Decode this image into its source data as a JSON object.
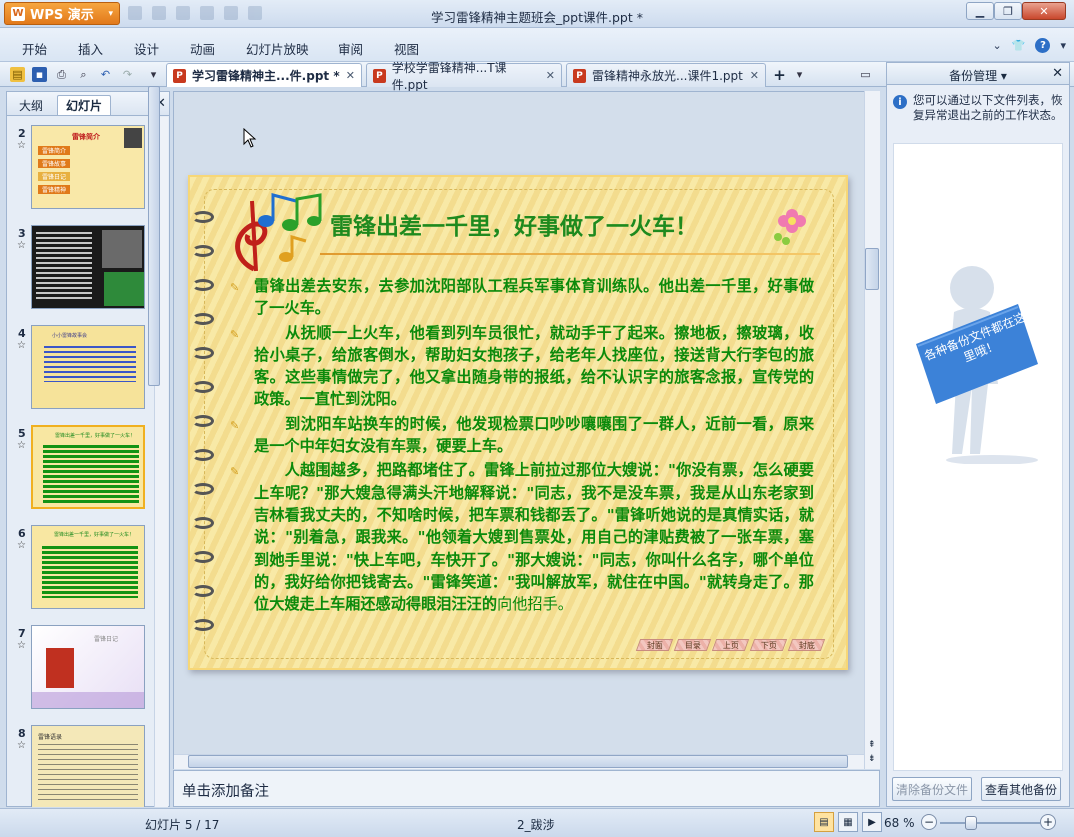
{
  "app": {
    "name": "WPS 演示",
    "window_title": "学习雷锋精神主题班会_ppt课件.ppt *"
  },
  "menu": [
    "开始",
    "插入",
    "设计",
    "动画",
    "幻灯片放映",
    "审阅",
    "视图"
  ],
  "doc_tabs": [
    {
      "label": "学习雷锋精神主...件.ppt *",
      "active": true
    },
    {
      "label": "学校学雷锋精神...T课件.ppt",
      "active": false
    },
    {
      "label": "雷锋精神永放光...课件1.ppt",
      "active": false
    }
  ],
  "left_panel": {
    "tabs": [
      "大纲",
      "幻灯片"
    ],
    "active_tab": "幻灯片",
    "slides": [
      {
        "num": "2",
        "title": "雷锋简介",
        "items": [
          "雷锋简介",
          "雷锋故事",
          "雷锋日记",
          "雷锋精神"
        ]
      },
      {
        "num": "3",
        "title": "雷锋"
      },
      {
        "num": "4",
        "title": "小小雷锋故事会"
      },
      {
        "num": "5",
        "title": "雷锋出差一千里，好事做了一火车！"
      },
      {
        "num": "6",
        "title": "雷锋出差一千里，好事做了一火车！"
      },
      {
        "num": "7",
        "title": "雷锋日记"
      },
      {
        "num": "8",
        "title": "雷锋语录"
      }
    ]
  },
  "slide": {
    "title": "雷锋出差一千里，好事做了一火车！",
    "paragraphs": [
      "雷锋出差去安东，去参加沈阳部队工程兵军事体育训练队。他出差一千里，好事做了一火车。",
      "　　从抚顺一上火车，他看到列车员很忙，就动手干了起来。擦地板，擦玻璃，收拾小桌子，给旅客倒水，帮助妇女抱孩子，给老年人找座位，接送背大行李包的旅客。这些事情做完了，他又拿出随身带的报纸，给不认识字的旅客念报，宣传党的政策。一直忙到沈阳。",
      "　　到沈阳车站换车的时候，他发现检票口吵吵嚷嚷围了一群人，近前一看，原来是一个中年妇女没有车票，硬要上车。",
      "　　人越围越多，把路都堵住了。雷锋上前拉过那位大嫂说：\"你没有票，怎么硬要上车呢？\"那大嫂急得满头汗地解释说：\"同志，我不是没车票，我是从山东老家到吉林看我丈夫的，不知啥时候，把车票和钱都丢了。\"雷锋听她说的是真情实话，就说：\"别着急，跟我来。\"他领着大嫂到售票处，用自己的津贴费被了一张车票，塞到她手里说：\"快上车吧，车快开了。\"那大嫂说：\"同志，你叫什么名字，哪个单位的，我好给你把钱寄去。\"雷锋笑道：\"我叫解放军，就住在中国。\"就转身走了。那位大嫂走上车厢还感动得眼泪汪汪的"
    ],
    "tail": "向他招手。",
    "nav": [
      "封面",
      "目录",
      "上页",
      "下页",
      "封底"
    ]
  },
  "notes": {
    "placeholder": "单击添加备注"
  },
  "right_panel": {
    "title": "备份管理",
    "info": "您可以通过以下文件列表，恢复异常退出之前的工作状态。",
    "figure_sign": "各种备份文件都在这里哦！",
    "clear_button": "清除备份文件",
    "other_button": "查看其他备份"
  },
  "status": {
    "slide_info": "幻灯片 5 / 17",
    "theme": "2_跋涉",
    "zoom": "68 %"
  },
  "colors": {
    "accent": "#e2791b",
    "slide_text": "#0b8a0b",
    "window": "#cfdcec"
  }
}
